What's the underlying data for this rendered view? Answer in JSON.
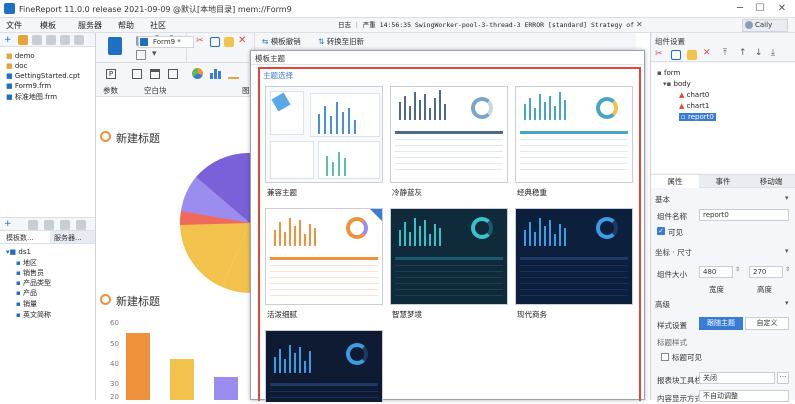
{
  "app": {
    "title": "FineReport 11.0.0 release 2021-09-09 @默认[本地目录]    mem://Form9",
    "user": "Caily"
  },
  "menu": {
    "items": [
      "文件",
      "模板",
      "服务器",
      "帮助",
      "社区"
    ]
  },
  "log": {
    "label": "日志",
    "level": "严重",
    "text": "14:56:35 SwingWorker-pool-3-thread-3 ERROR [standard] Strategy of DSQueryEntity[tplPa..."
  },
  "left": {
    "files": [
      "demo",
      "doc",
      "GettingStarted.cpt",
      "Form9.frm",
      "标准地图.frm"
    ],
    "tabs": [
      "模板数...",
      "服务器..."
    ],
    "dataset": "ds1",
    "fields": [
      "地区",
      "销售员",
      "产品类型",
      "产品",
      "销量",
      "英文简称"
    ]
  },
  "toolbar": {
    "form_tab": "Form9 *",
    "undo_redo": "模板撤销",
    "convert": "转换至旧新",
    "param_label": "参数",
    "blank_label": "空白块"
  },
  "canvas": {
    "title1": "新建标题",
    "title2": "新建标题",
    "axis_ticks": [
      "60",
      "50",
      "40",
      "30",
      "20"
    ]
  },
  "dialog": {
    "title": "模板主题",
    "section": "主题选择",
    "themes": [
      {
        "name": "兼容主题"
      },
      {
        "name": "冷静蓝灰"
      },
      {
        "name": "经典稳重"
      },
      {
        "name": "活泼细腻"
      },
      {
        "name": "智慧梦境"
      },
      {
        "name": "现代商务"
      },
      {
        "name": ""
      }
    ]
  },
  "right": {
    "header": "组件设置",
    "tree": [
      "form",
      "body",
      "chart0",
      "chart1",
      "report0"
    ],
    "tabs": [
      "属性",
      "事件",
      "移动端"
    ],
    "basic": "基本",
    "name_label": "组件名称",
    "name_value": "report0",
    "visible_label": "可见",
    "coord_label": "坐标 · 尺寸",
    "size_label": "组件大小",
    "width_value": "480",
    "height_value": "270",
    "width_caption": "宽度",
    "height_caption": "高度",
    "advanced": "高级",
    "style_label": "样式设置",
    "style_btn1": "跟随主题",
    "style_btn2": "自定义",
    "title_style": "标题样式",
    "title_visible": "标题可见",
    "report_toolbar": "报表块工具栏",
    "report_toolbar_value": "关闭",
    "extra": "内容显示方式",
    "extra_value": "不自动调整"
  },
  "colors": {
    "accent": "#1f6fc5",
    "dialog_border": "#e0463c",
    "btn_active": "#3a7bd5"
  }
}
